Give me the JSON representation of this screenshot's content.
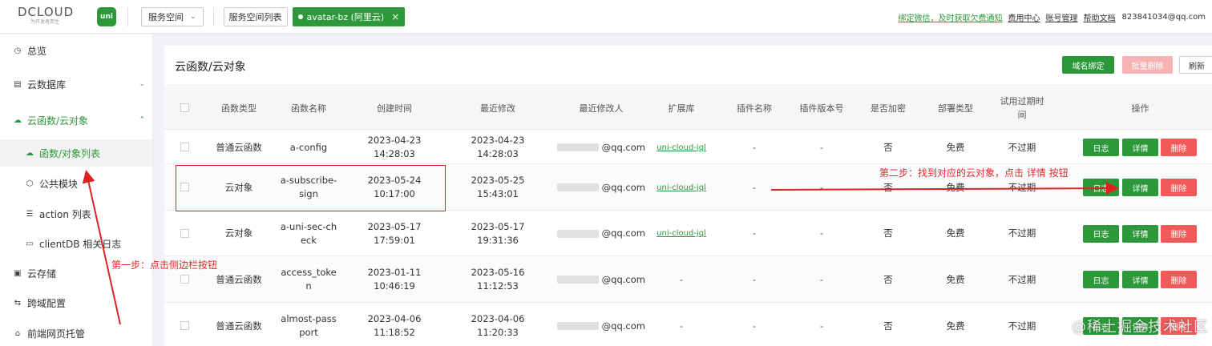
{
  "header": {
    "logo_text": "DCLOUD",
    "logo_sub": "为开发者而生",
    "uni_label": "uni",
    "space_select": "服务空间",
    "space_list_button": "服务空间列表",
    "space_tag": "avatar-bz (阿里云)",
    "space_tag_close": "×",
    "nav": {
      "notice": "绑定微信，及时获取欠费通知",
      "billing": "费用中心",
      "account": "账号管理",
      "help": "帮助文档",
      "email": "823841034@qq.com"
    }
  },
  "sidebar": {
    "items": [
      {
        "label": "总览",
        "icon": "dashboard-icon"
      },
      {
        "label": "云数据库",
        "icon": "database-icon"
      },
      {
        "label": "云函数/云对象",
        "icon": "cloud-icon"
      },
      {
        "label": "函数/对象列表",
        "icon": "cloud-outline-icon"
      },
      {
        "label": "公共模块",
        "icon": "module-icon"
      },
      {
        "label": "action 列表",
        "icon": "list-icon"
      },
      {
        "label": "clientDB 相关日志",
        "icon": "doc-icon"
      },
      {
        "label": "云存储",
        "icon": "storage-icon"
      },
      {
        "label": "跨域配置",
        "icon": "cors-icon"
      },
      {
        "label": "前端网页托管",
        "icon": "hosting-icon"
      }
    ]
  },
  "panel": {
    "title": "云函数/云对象",
    "buttons": {
      "domain": "域名绑定",
      "batch_delete": "批量删除",
      "refresh": "刷新"
    }
  },
  "table": {
    "headers": [
      "函数类型",
      "函数名称",
      "创建时间",
      "最近修改",
      "最近修改人",
      "扩展库",
      "插件名称",
      "插件版本号",
      "是否加密",
      "部署类型",
      "试用过期时\n间",
      "操作"
    ],
    "rows": [
      {
        "type": "普通云函数",
        "name": "a-config",
        "created": "2023-04-23 14:28:03",
        "modified": "2023-04-23 14:28:03",
        "modifier": "@qq.com",
        "ext": "uni-cloud-jql",
        "plugin": "-",
        "version": "-",
        "encrypted": "否",
        "deploy": "免费",
        "expire": "不过期"
      },
      {
        "type": "云对象",
        "name": "a-subscribe-\nsign",
        "created": "2023-05-24 10:17:00",
        "modified": "2023-05-25 15:43:01",
        "modifier": "@qq.com",
        "ext": "uni-cloud-jql",
        "plugin": "-",
        "version": "-",
        "encrypted": "否",
        "deploy": "免费",
        "expire": "不过期"
      },
      {
        "type": "云对象",
        "name": "a-uni-sec-ch\neck",
        "created": "2023-05-17 17:59:01",
        "modified": "2023-05-17 19:31:36",
        "modifier": "@qq.com",
        "ext": "uni-cloud-jql",
        "plugin": "-",
        "version": "-",
        "encrypted": "否",
        "deploy": "免费",
        "expire": "不过期"
      },
      {
        "type": "普通云函数",
        "name": "access_toke\nn",
        "created": "2023-01-11 10:46:19",
        "modified": "2023-05-16 11:12:53",
        "modifier": "@qq.com",
        "ext": "-",
        "plugin": "-",
        "version": "-",
        "encrypted": "否",
        "deploy": "免费",
        "expire": "不过期"
      },
      {
        "type": "普通云函数",
        "name": "almost-pass\nport",
        "created": "2023-04-06 11:18:52",
        "modified": "2023-04-06 11:20:33",
        "modifier": "@qq.com",
        "ext": "-",
        "plugin": "-",
        "version": "-",
        "encrypted": "否",
        "deploy": "免费",
        "expire": "不过期"
      }
    ],
    "actions": {
      "log": "日志",
      "detail": "详情",
      "delete": "删除"
    }
  },
  "annotations": {
    "step1": "第一步：点击侧边栏按钮",
    "step2": "第二步：找到对应的云对象，点击 详情 按钮",
    "color": "#e02b2b"
  },
  "watermark": "@稀土掘金技术社区",
  "colors": {
    "primary": "#2b9939",
    "danger": "#f25a5a",
    "danger_disabled": "#f7b3b3"
  }
}
